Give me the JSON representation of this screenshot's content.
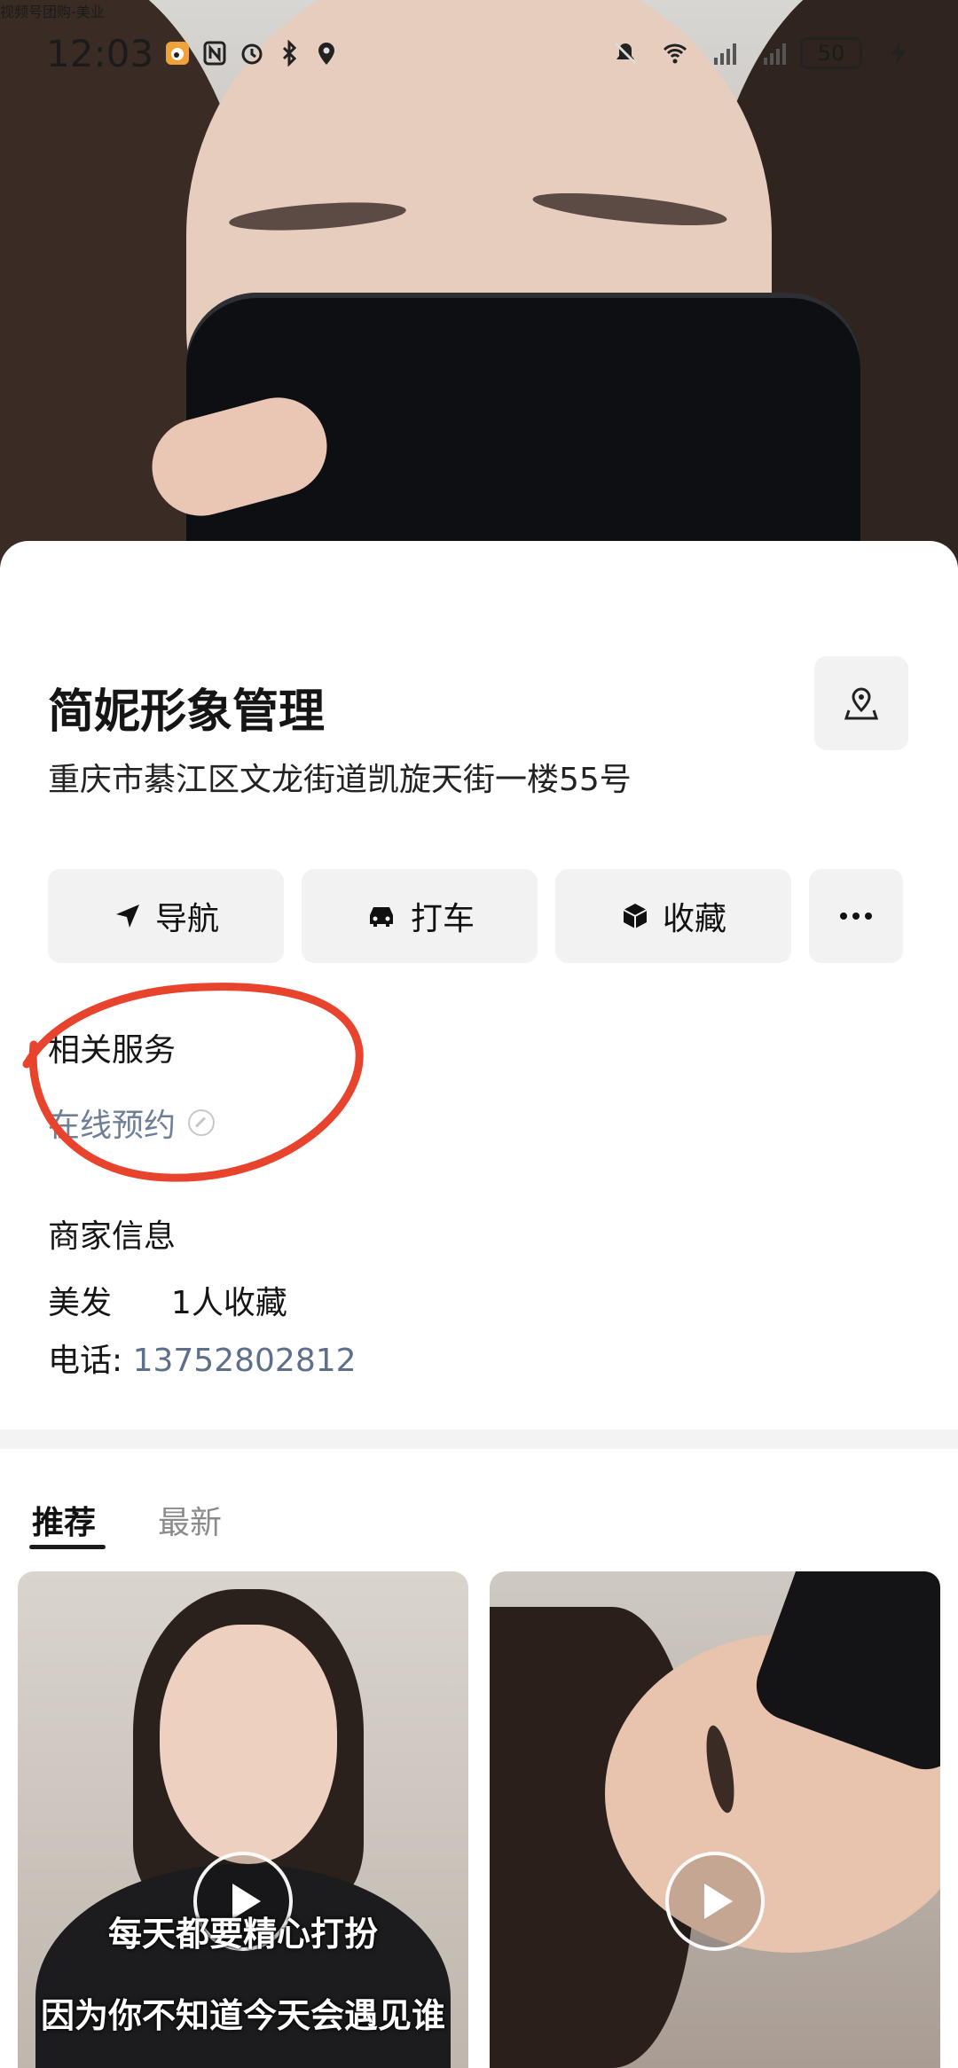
{
  "status_bar": {
    "time": "12:03",
    "battery": "50"
  },
  "hero": {
    "overlay_text": "视频号团购-美业"
  },
  "shop": {
    "name": "简妮形象管理",
    "address": "重庆市綦江区文龙街道凯旋天街一楼55号"
  },
  "actions": {
    "navigate": "导航",
    "taxi": "打车",
    "favorite": "收藏"
  },
  "related": {
    "title": "相关服务",
    "booking": "在线预约"
  },
  "merchant": {
    "title": "商家信息",
    "category": "美发",
    "favorites": "1人收藏",
    "phone_label": "电话: ",
    "phone": "13752802812"
  },
  "tabs": {
    "recommend": "推荐",
    "latest": "最新"
  },
  "videos": [
    {
      "caption_line1": "每天都要精心打扮",
      "caption_line2": "因为你不知道今天会遇见谁"
    },
    {
      "caption_line1": "",
      "caption_line2": ""
    }
  ],
  "colors": {
    "accent_red": "#e8432d",
    "link": "#5e7089"
  }
}
